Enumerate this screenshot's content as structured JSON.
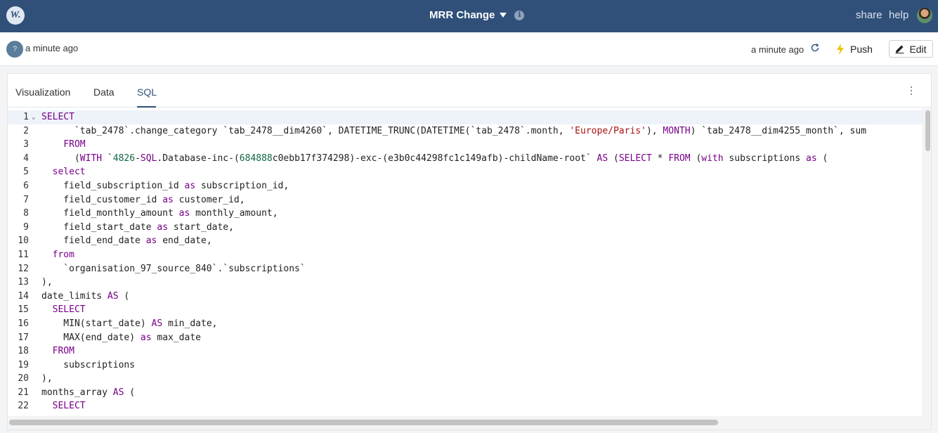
{
  "header": {
    "logo_text": "W.",
    "title": "MRR Change",
    "share_label": "share",
    "help_label": "help"
  },
  "subheader": {
    "help_badge": "?",
    "left_timestamp": "a minute ago",
    "right_timestamp": "a minute ago",
    "push_label": "Push",
    "edit_label": "Edit"
  },
  "tabs": {
    "visualization": "Visualization",
    "data": "Data",
    "sql": "SQL",
    "active": "SQL"
  },
  "editor": {
    "line_numbers": [
      "1",
      "2",
      "3",
      "4",
      "5",
      "6",
      "7",
      "8",
      "9",
      "10",
      "11",
      "12",
      "13",
      "14",
      "15",
      "16",
      "17",
      "18",
      "19",
      "20",
      "21",
      "22"
    ],
    "lines": [
      "SELECT",
      "      `tab_2478`.change_category `tab_2478__dim4260`, DATETIME_TRUNC(DATETIME(`tab_2478`.month, 'Europe/Paris'), MONTH) `tab_2478__dim4255_month`, sum",
      "    FROM",
      "      (WITH `4826-SQL.Database-inc-(684888c0ebb17f374298)-exc-(e3b0c44298fc1c149afb)-childName-root` AS (SELECT * FROM (with subscriptions as (",
      "  select",
      "    field_subscription_id as subscription_id,",
      "    field_customer_id as customer_id,",
      "    field_monthly_amount as monthly_amount,",
      "    field_start_date as start_date,",
      "    field_end_date as end_date,",
      "  from",
      "    `organisation_97_source_840`.`subscriptions`",
      "),",
      "date_limits AS (",
      "  SELECT",
      "    MIN(start_date) AS min_date,",
      "    MAX(end_date) as max_date",
      "  FROM",
      "    subscriptions",
      "),",
      "months_array AS (",
      "  SELECT"
    ]
  },
  "colors": {
    "topbar": "#30507a",
    "keyword": "#770088",
    "string": "#aa1111",
    "number": "#116644"
  }
}
